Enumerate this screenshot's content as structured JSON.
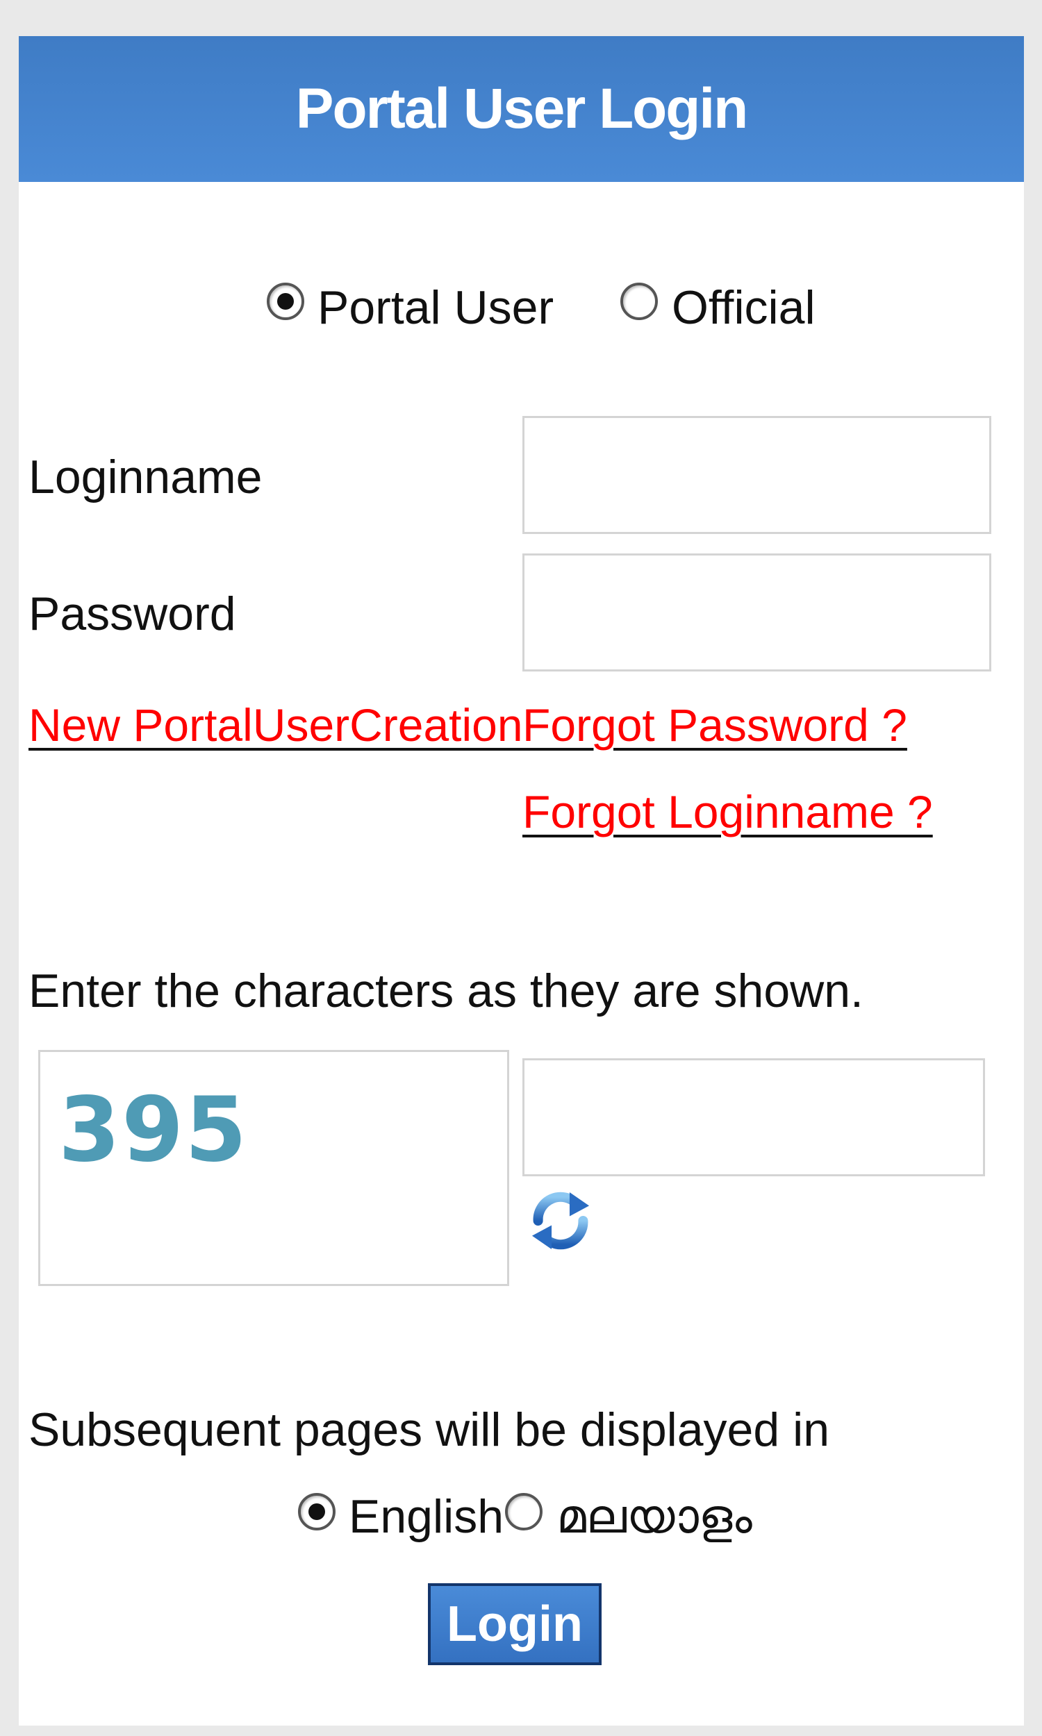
{
  "header": {
    "title": "Portal User Login"
  },
  "user_type": {
    "options": [
      {
        "label": "Portal User",
        "selected": true
      },
      {
        "label": "Official",
        "selected": false
      }
    ]
  },
  "form": {
    "loginname_label": "Loginname",
    "loginname_value": "",
    "password_label": "Password",
    "password_value": ""
  },
  "links": {
    "new_user": "New PortalUserCreation",
    "forgot_password": "Forgot Password ?",
    "forgot_loginname": "Forgot Loginname ?"
  },
  "captcha": {
    "instruction": "Enter the characters as they are shown.",
    "image_text": "395",
    "input_value": "",
    "refresh_icon": "refresh-icon"
  },
  "language": {
    "prompt": "Subsequent pages will be displayed in",
    "options": [
      {
        "label": "English",
        "selected": true
      },
      {
        "label": "മലയാളം",
        "selected": false
      }
    ]
  },
  "login_button": "Login",
  "colors": {
    "header_bg": "#4a8ad6",
    "link": "#ff0000",
    "button_bg": "#3d7dcc",
    "captcha_text": "#4f9bb5"
  }
}
